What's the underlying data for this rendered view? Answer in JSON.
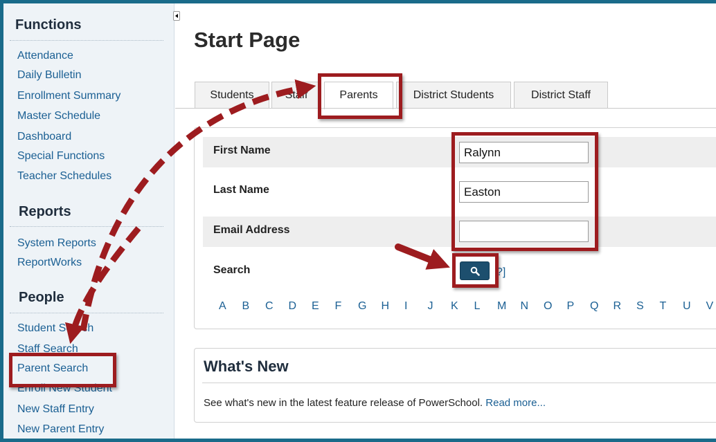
{
  "sidebar": {
    "sections": [
      {
        "title": "Functions",
        "items": [
          "Attendance",
          "Daily Bulletin",
          "Enrollment Summary",
          "Master Schedule",
          "Dashboard",
          "Special Functions",
          "Teacher Schedules"
        ]
      },
      {
        "title": "Reports",
        "items": [
          "System Reports",
          "ReportWorks"
        ]
      },
      {
        "title": "People",
        "items": [
          "Student Search",
          "Staff Search",
          "Parent Search",
          "Enroll New Student",
          "New Staff Entry",
          "New Parent Entry"
        ]
      }
    ]
  },
  "page": {
    "title": "Start Page"
  },
  "tabs": [
    {
      "label": "Students"
    },
    {
      "label": "Staff"
    },
    {
      "label": "Parents",
      "active": true
    },
    {
      "label": "District Students"
    },
    {
      "label": "District Staff"
    }
  ],
  "form": {
    "first_name": {
      "label": "First Name",
      "value": "Ralynn"
    },
    "last_name": {
      "label": "Last Name",
      "value": "Easton"
    },
    "email": {
      "label": "Email Address",
      "value": ""
    },
    "search": {
      "label": "Search",
      "help": "?]"
    }
  },
  "alphabet": [
    "A",
    "B",
    "C",
    "D",
    "E",
    "F",
    "G",
    "H",
    "I",
    "J",
    "K",
    "L",
    "M",
    "N",
    "O",
    "P",
    "Q",
    "R",
    "S",
    "T",
    "U",
    "V"
  ],
  "news": {
    "title": "What's New",
    "text": "See what's new in the latest feature release of PowerSchool.",
    "link": "Read more..."
  },
  "colors": {
    "accent": "#1a6b8a",
    "link": "#1a5f93",
    "annotation": "#9d1c1f"
  },
  "icons": {
    "search_button": "magnifier-icon",
    "collapse": "triangle-left-icon"
  }
}
